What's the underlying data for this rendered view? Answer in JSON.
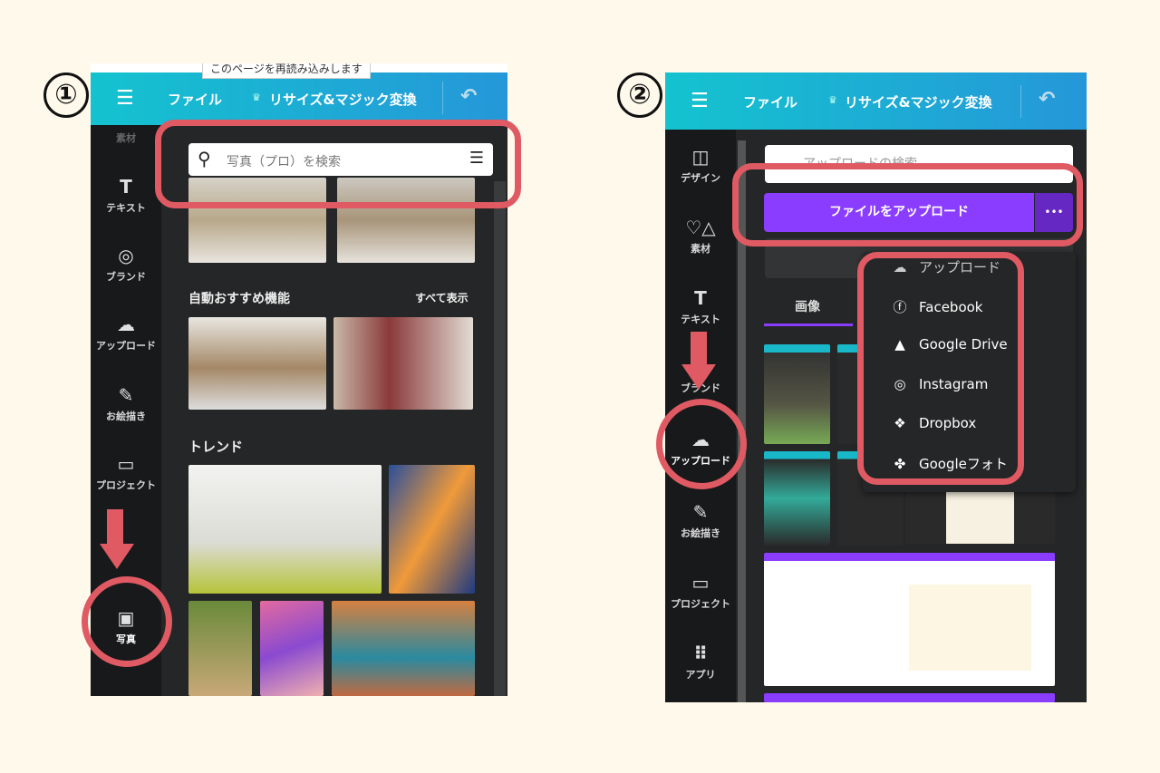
{
  "step1": {
    "number": "①",
    "tooltip": "このページを再読み込みします",
    "header": {
      "menu_icon": "hamburger-icon",
      "file": "ファイル",
      "resize": "リサイズ&マジック変換",
      "crown": "♛"
    },
    "sidebar": [
      "素材",
      "テキスト",
      "ブランド",
      "アップロード",
      "お絵描き",
      "プロジェクト",
      "写真"
    ],
    "search_placeholder": "写真（プロ）を検索",
    "section1": "自動おすすめ機能",
    "see_all": "すべて表示",
    "section2": "トレンド"
  },
  "step2": {
    "number": "②",
    "header": {
      "file": "ファイル",
      "resize": "リサイズ&マジック変換",
      "crown": "♛"
    },
    "sidebar": [
      "デザイン",
      "素材",
      "テキスト",
      "ブランド",
      "アップロード",
      "お絵描き",
      "プロジェクト",
      "アプリ"
    ],
    "search_placeholder": "アップロードの検索",
    "upload_button": "ファイルをアップロード",
    "more": "•••",
    "tab_images": "画像",
    "menu": [
      "アップロード",
      "Facebook",
      "Google Drive",
      "Instagram",
      "Dropbox",
      "Googleフォト"
    ]
  },
  "colors": {
    "highlight": "#e05a63",
    "accent": "#8b3dff"
  }
}
